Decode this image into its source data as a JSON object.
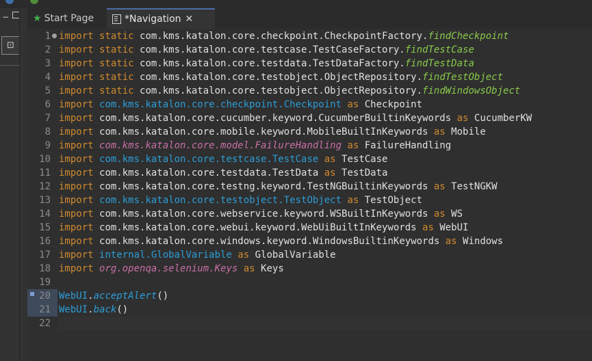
{
  "tabs": [
    {
      "label": "Start Page",
      "icon": "star-icon",
      "active": false
    },
    {
      "label": "*Navigation",
      "icon": "script-icon",
      "active": true
    }
  ],
  "left_panel": {
    "minimize_glyph": "−",
    "button_glyph": "⊡"
  },
  "code_lines": [
    {
      "n": "1",
      "tokens": [
        [
          "kw",
          "import static "
        ],
        [
          "pkg-plain",
          "com.kms.katalon.core.checkpoint.CheckpointFactory."
        ],
        [
          "fn",
          "findCheckpoint"
        ]
      ]
    },
    {
      "n": "2",
      "tokens": [
        [
          "kw",
          "import static "
        ],
        [
          "pkg-plain",
          "com.kms.katalon.core.testcase.TestCaseFactory."
        ],
        [
          "fn",
          "findTestCase"
        ]
      ]
    },
    {
      "n": "3",
      "tokens": [
        [
          "kw",
          "import static "
        ],
        [
          "pkg-plain",
          "com.kms.katalon.core.testdata.TestDataFactory."
        ],
        [
          "fn",
          "findTestData"
        ]
      ]
    },
    {
      "n": "4",
      "tokens": [
        [
          "kw",
          "import static "
        ],
        [
          "pkg-plain",
          "com.kms.katalon.core.testobject.ObjectRepository."
        ],
        [
          "fn",
          "findTestObject"
        ]
      ]
    },
    {
      "n": "5",
      "tokens": [
        [
          "kw",
          "import static "
        ],
        [
          "pkg-plain",
          "com.kms.katalon.core.testobject.ObjectRepository."
        ],
        [
          "fn",
          "findWindowsObject"
        ]
      ]
    },
    {
      "n": "6",
      "tokens": [
        [
          "kw",
          "import "
        ],
        [
          "pkg-blue",
          "com.kms.katalon.core.checkpoint.Checkpoint"
        ],
        [
          "kw",
          " as "
        ],
        [
          "pkg-plain",
          "Checkpoint"
        ]
      ]
    },
    {
      "n": "7",
      "tokens": [
        [
          "kw",
          "import "
        ],
        [
          "pkg-plain",
          "com.kms.katalon.core.cucumber.keyword.CucumberBuiltinKeywords"
        ],
        [
          "kw",
          " as "
        ],
        [
          "pkg-plain",
          "CucumberKW"
        ]
      ]
    },
    {
      "n": "8",
      "tokens": [
        [
          "kw",
          "import "
        ],
        [
          "pkg-plain",
          "com.kms.katalon.core.mobile.keyword.MobileBuiltInKeywords"
        ],
        [
          "kw",
          " as "
        ],
        [
          "pkg-plain",
          "Mobile"
        ]
      ]
    },
    {
      "n": "9",
      "tokens": [
        [
          "kw",
          "import "
        ],
        [
          "pkg-pink",
          "com.kms.katalon.core.model.FailureHandling"
        ],
        [
          "kw",
          " as "
        ],
        [
          "pkg-plain",
          "FailureHandling"
        ]
      ]
    },
    {
      "n": "10",
      "tokens": [
        [
          "kw",
          "import "
        ],
        [
          "pkg-blue",
          "com.kms.katalon.core.testcase.TestCase"
        ],
        [
          "kw",
          " as "
        ],
        [
          "pkg-plain",
          "TestCase"
        ]
      ]
    },
    {
      "n": "11",
      "tokens": [
        [
          "kw",
          "import "
        ],
        [
          "pkg-plain",
          "com.kms.katalon.core.testdata.TestData"
        ],
        [
          "kw",
          " as "
        ],
        [
          "pkg-plain",
          "TestData"
        ]
      ]
    },
    {
      "n": "12",
      "tokens": [
        [
          "kw",
          "import "
        ],
        [
          "pkg-plain",
          "com.kms.katalon.core.testng.keyword.TestNGBuiltinKeywords"
        ],
        [
          "kw",
          " as "
        ],
        [
          "pkg-plain",
          "TestNGKW"
        ]
      ]
    },
    {
      "n": "13",
      "tokens": [
        [
          "kw",
          "import "
        ],
        [
          "pkg-blue",
          "com.kms.katalon.core.testobject.TestObject"
        ],
        [
          "kw",
          " as "
        ],
        [
          "pkg-plain",
          "TestObject"
        ]
      ]
    },
    {
      "n": "14",
      "tokens": [
        [
          "kw",
          "import "
        ],
        [
          "pkg-plain",
          "com.kms.katalon.core.webservice.keyword.WSBuiltInKeywords"
        ],
        [
          "kw",
          " as "
        ],
        [
          "pkg-plain",
          "WS"
        ]
      ]
    },
    {
      "n": "15",
      "tokens": [
        [
          "kw",
          "import "
        ],
        [
          "pkg-plain",
          "com.kms.katalon.core.webui.keyword.WebUiBuiltInKeywords"
        ],
        [
          "kw",
          " as "
        ],
        [
          "pkg-plain",
          "WebUI"
        ]
      ]
    },
    {
      "n": "16",
      "tokens": [
        [
          "kw",
          "import "
        ],
        [
          "pkg-plain",
          "com.kms.katalon.core.windows.keyword.WindowsBuiltinKeywords"
        ],
        [
          "kw",
          " as "
        ],
        [
          "pkg-plain",
          "Windows"
        ]
      ]
    },
    {
      "n": "17",
      "tokens": [
        [
          "kw",
          "import "
        ],
        [
          "pkg-blue",
          "internal.GlobalVariable"
        ],
        [
          "kw",
          " as "
        ],
        [
          "pkg-plain",
          "GlobalVariable"
        ]
      ]
    },
    {
      "n": "18",
      "tokens": [
        [
          "kw",
          "import "
        ],
        [
          "pkg-pink",
          "org.openqa.selenium.Keys"
        ],
        [
          "kw",
          " as "
        ],
        [
          "pkg-plain",
          "Keys"
        ]
      ]
    },
    {
      "n": "19",
      "tokens": []
    },
    {
      "n": "20",
      "tokens": [
        [
          "webui",
          "WebUI"
        ],
        [
          "pkg-plain",
          "."
        ],
        [
          "call",
          "acceptAlert"
        ],
        [
          "pkg-plain",
          "()"
        ]
      ]
    },
    {
      "n": "21",
      "tokens": [
        [
          "webui",
          "WebUI"
        ],
        [
          "pkg-plain",
          "."
        ],
        [
          "call",
          "back"
        ],
        [
          "pkg-plain",
          "()"
        ]
      ]
    },
    {
      "n": "22",
      "tokens": []
    }
  ],
  "colors": {
    "keyword": "#d08a2f",
    "type_ref": "#2c9dd6",
    "static_method": "#8ac94b",
    "enum_ref": "#c86fa6",
    "background": "#2f2f2f"
  }
}
